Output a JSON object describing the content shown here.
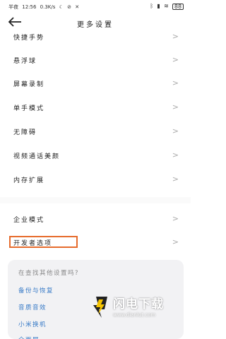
{
  "status_bar": {
    "time": "12:56",
    "carrier_prefix": "半夜",
    "speed": "0.3K/s",
    "battery": "88"
  },
  "header": {
    "title": "更多设置",
    "back_icon": "back-arrow-icon"
  },
  "settings": [
    {
      "label": "快捷手势"
    },
    {
      "label": "悬浮球"
    },
    {
      "label": "屏幕录制"
    },
    {
      "label": "单手模式"
    },
    {
      "label": "无障碍"
    },
    {
      "label": "视频通话美颜"
    },
    {
      "label": "内存扩展"
    }
  ],
  "settings2": [
    {
      "label": "企业模式"
    },
    {
      "label": "开发者选项"
    }
  ],
  "chevron": ">",
  "suggestion_card": {
    "question": "在查找其他设置吗?",
    "links": [
      "备份与恢复",
      "音质音效",
      "小米换机",
      "全面屏"
    ]
  },
  "watermark": {
    "name": "闪电下载",
    "url": "www.dianlut.com"
  },
  "colors": {
    "highlight": "#e66b2c",
    "link": "#3478c6"
  }
}
